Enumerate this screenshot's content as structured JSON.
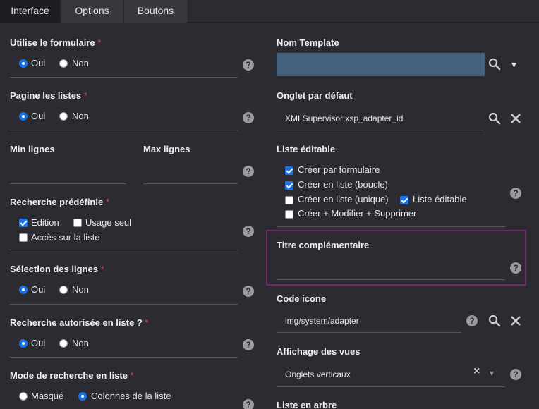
{
  "tabs": [
    {
      "label": "Interface"
    },
    {
      "label": "Options"
    },
    {
      "label": "Boutons"
    }
  ],
  "left": {
    "utilise_formulaire": {
      "label": "Utilise le formulaire",
      "required": "*",
      "options": [
        "Oui",
        "Non"
      ]
    },
    "pagine_listes": {
      "label": "Pagine les listes",
      "required": "*",
      "options": [
        "Oui",
        "Non"
      ]
    },
    "min_lignes": {
      "label": "Min lignes"
    },
    "max_lignes": {
      "label": "Max lignes"
    },
    "recherche_predefinie": {
      "label": "Recherche prédéfinie",
      "required": "*",
      "options": [
        "Edition",
        "Usage seul",
        "Accès sur la liste"
      ]
    },
    "selection_lignes": {
      "label": "Sélection des lignes",
      "required": "*",
      "options": [
        "Oui",
        "Non"
      ]
    },
    "recherche_autorisee": {
      "label": "Recherche autorisée en liste ?",
      "required": "*",
      "options": [
        "Oui",
        "Non"
      ]
    },
    "mode_recherche": {
      "label": "Mode de recherche en liste",
      "required": "*",
      "options": [
        "Masqué",
        "Colonnes de la liste"
      ]
    }
  },
  "right": {
    "nom_template": {
      "label": "Nom Template"
    },
    "onglet_defaut": {
      "label": "Onglet par défaut",
      "value": "XMLSupervisor;xsp_adapter_id"
    },
    "liste_editable": {
      "label": "Liste éditable",
      "options": [
        "Créer par formulaire",
        "Créer en liste (boucle)",
        "Créer en liste (unique)",
        "Liste éditable",
        "Créer + Modifier + Supprimer"
      ]
    },
    "titre_complementaire": {
      "label": "Titre complémentaire"
    },
    "code_icone": {
      "label": "Code icone",
      "value": "img/system/adapter"
    },
    "affichage_vues": {
      "label": "Affichage des vues",
      "value": "Onglets verticaux"
    },
    "liste_arbre": {
      "label": "Liste en arbre"
    }
  },
  "icons": {
    "help": "?",
    "search": "search-icon",
    "clear": "×",
    "dropdown": "▾"
  },
  "colors": {
    "accent": "#1a73e8",
    "required": "#e0505a",
    "highlight": "#6e2a6a",
    "field": "#44617e"
  }
}
